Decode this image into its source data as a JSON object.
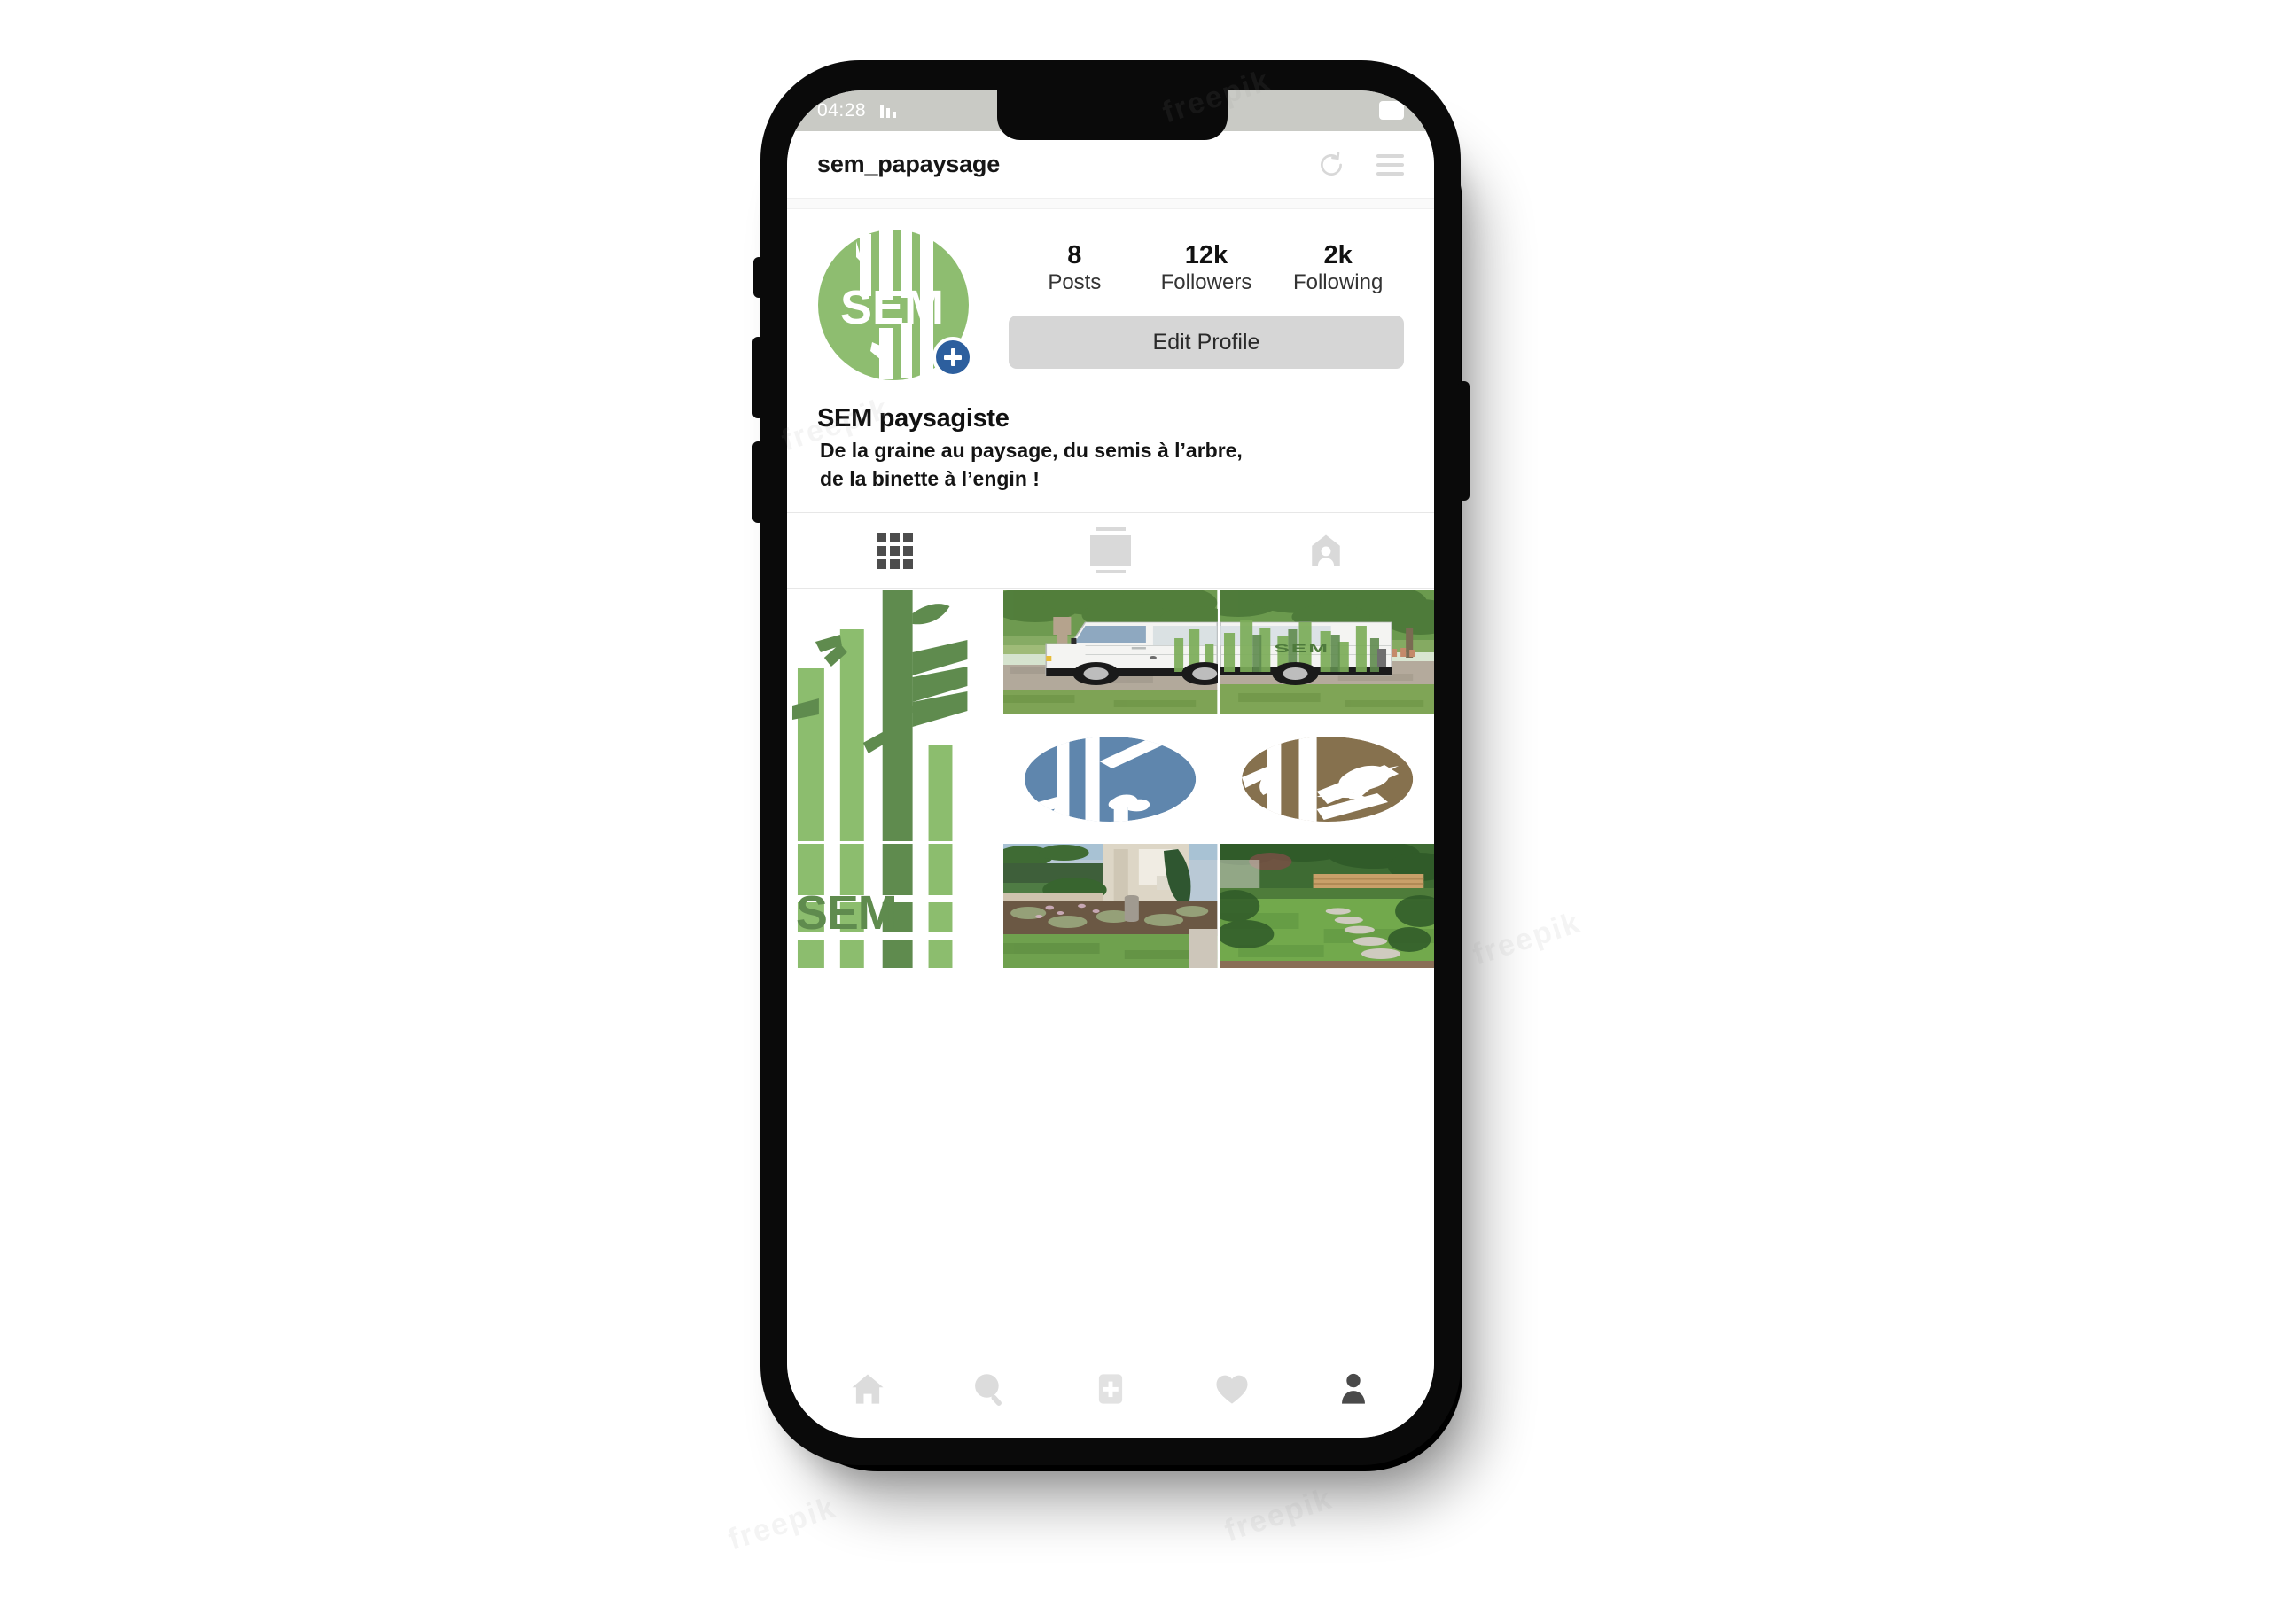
{
  "status_bar": {
    "time": "04:28",
    "signal_icon": "signal-bars-icon",
    "battery_icon": "battery-icon"
  },
  "app_bar": {
    "username": "sem_papaysage",
    "refresh_icon": "refresh-icon",
    "menu_icon": "hamburger-menu-icon"
  },
  "profile": {
    "avatar": {
      "name": "SEM",
      "icon": "sem-logo-avatar",
      "circle_color": "#8ebd70",
      "add_story_badge": {
        "icon": "plus-badge-icon",
        "color": "#2d5f9e"
      }
    },
    "stats": [
      {
        "num": "8",
        "label": "Posts"
      },
      {
        "num": "12k",
        "label": "Followers"
      },
      {
        "num": "2k",
        "label": "Following"
      }
    ],
    "edit_profile_label": "Edit Profile",
    "display_name": "SEM paysagiste",
    "bio_line_1": "De la graine au paysage, du semis à l’arbre,",
    "bio_line_2": "de la binette à l’engin !"
  },
  "tabs": [
    {
      "id": "grid",
      "icon": "grid-icon",
      "active": true
    },
    {
      "id": "feed",
      "icon": "feed-list-icon",
      "active": false
    },
    {
      "id": "tagged",
      "icon": "tagged-person-icon",
      "active": false
    }
  ],
  "grid_posts": [
    {
      "position": "col1-row1-2",
      "type": "illustration",
      "title": "SEM bamboo poster",
      "colors": {
        "light_green": "#8cbd6e",
        "dark_green": "#5f8b4e"
      }
    },
    {
      "position": "col2-row1",
      "type": "photo",
      "title": "SEM branded van in park (left half)"
    },
    {
      "position": "col3-row1",
      "type": "photo",
      "title": "SEM branded van in park (right half)"
    },
    {
      "position": "col2-row2",
      "type": "illustration",
      "title": "Blue circle logo with squirrel",
      "colors": {
        "circle": "#5f86ad"
      }
    },
    {
      "position": "col3-row2",
      "type": "illustration",
      "title": "Brown circle logo with bird",
      "colors": {
        "circle": "#86714e"
      }
    },
    {
      "position": "col1-row3",
      "type": "illustration",
      "title": "SEM bamboo poster lower - SEM lettering"
    },
    {
      "position": "col2-row3",
      "type": "photo",
      "title": "Front garden with flower bed and standing stone"
    },
    {
      "position": "col3-row3",
      "type": "photo",
      "title": "Back garden lawn with stepping stones and wooden fence"
    }
  ],
  "bottom_nav": [
    {
      "id": "home",
      "icon": "home-icon",
      "active": false
    },
    {
      "id": "search",
      "icon": "search-icon",
      "active": false
    },
    {
      "id": "add",
      "icon": "add-post-icon",
      "active": false
    },
    {
      "id": "activity",
      "icon": "heart-icon",
      "active": false
    },
    {
      "id": "profile",
      "icon": "profile-person-icon",
      "active": true
    }
  ]
}
